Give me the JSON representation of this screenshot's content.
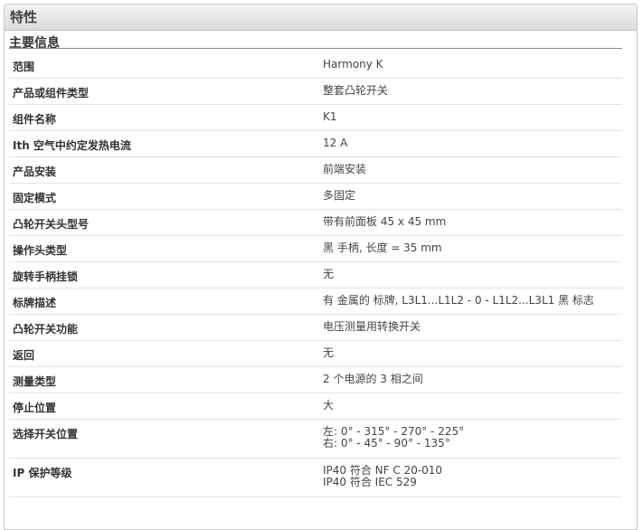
{
  "header": {
    "title": "特性"
  },
  "section": {
    "title": "主要信息"
  },
  "rows": [
    {
      "key": "范围",
      "value": [
        "Harmony K"
      ]
    },
    {
      "key": "产品或组件类型",
      "value": [
        "整套凸轮开关"
      ]
    },
    {
      "key": "组件名称",
      "value": [
        "K1"
      ]
    },
    {
      "key": "Ith 空气中约定发热电流",
      "value": [
        "12 A"
      ]
    },
    {
      "key": "产品安装",
      "value": [
        "前端安装"
      ]
    },
    {
      "key": "固定模式",
      "value": [
        "多固定"
      ]
    },
    {
      "key": "凸轮开关头型号",
      "value": [
        "带有前面板 45 x 45 mm"
      ]
    },
    {
      "key": "操作头类型",
      "value": [
        "黑 手柄, 长度 = 35 mm"
      ]
    },
    {
      "key": "旋转手柄挂锁",
      "value": [
        "无"
      ]
    },
    {
      "key": "标牌描述",
      "value": [
        "有 金属的 标牌, L3L1...L1L2 - 0 - L1L2...L3L1 黑 标志"
      ]
    },
    {
      "key": "凸轮开关功能",
      "value": [
        "电压测量用转换开关"
      ]
    },
    {
      "key": "返回",
      "value": [
        "无"
      ]
    },
    {
      "key": "测量类型",
      "value": [
        "2 个电源的 3 相之间"
      ]
    },
    {
      "key": "停止位置",
      "value": [
        "大"
      ]
    },
    {
      "key": "选择开关位置",
      "value": [
        "左: 0° - 315° - 270° - 225°",
        "右: 0° - 45° - 90° - 135°"
      ]
    },
    {
      "key": "IP 保护等级",
      "value": [
        "IP40 符合 NF C 20-010",
        "IP40 符合 IEC 529"
      ]
    }
  ]
}
